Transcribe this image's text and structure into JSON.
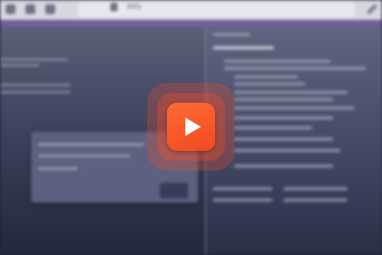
{
  "browser": {
    "url_text": "Bitly"
  },
  "colors": {
    "accent": "#6f5f99",
    "play_button": "#f14a20",
    "background": "#1c2033"
  },
  "icons": {
    "back": "back-arrow-icon",
    "forward": "forward-arrow-icon",
    "reload": "reload-icon",
    "lock": "lock-icon",
    "edit": "pencil-icon",
    "play": "play-icon"
  }
}
